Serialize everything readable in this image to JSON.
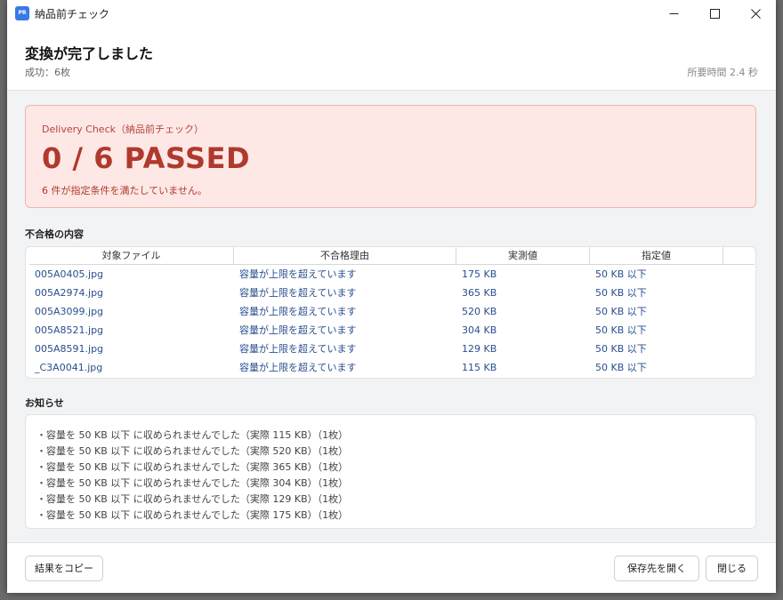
{
  "window": {
    "app_icon_text": "PR",
    "title": "納品前チェック"
  },
  "header": {
    "title": "変換が完了しました",
    "subtitle": "成功：6枚",
    "elapsed": "所要時間 2.4 秒"
  },
  "alert": {
    "label": "Delivery Check（納品前チェック）",
    "result": "0 / 6 PASSED",
    "description": "6 件が指定条件を満たしていません。"
  },
  "failures": {
    "section_title": "不合格の内容",
    "columns": [
      "対象ファイル",
      "不合格理由",
      "実測値",
      "指定値"
    ],
    "rows": [
      {
        "file": "005A0405.jpg",
        "reason": "容量が上限を超えています",
        "actual": "175 KB",
        "spec": "50 KB 以下"
      },
      {
        "file": "005A2974.jpg",
        "reason": "容量が上限を超えています",
        "actual": "365 KB",
        "spec": "50 KB 以下"
      },
      {
        "file": "005A3099.jpg",
        "reason": "容量が上限を超えています",
        "actual": "520 KB",
        "spec": "50 KB 以下"
      },
      {
        "file": "005A8521.jpg",
        "reason": "容量が上限を超えています",
        "actual": "304 KB",
        "spec": "50 KB 以下"
      },
      {
        "file": "005A8591.jpg",
        "reason": "容量が上限を超えています",
        "actual": "129 KB",
        "spec": "50 KB 以下"
      },
      {
        "file": "_C3A0041.jpg",
        "reason": "容量が上限を超えています",
        "actual": "115 KB",
        "spec": "50 KB 以下"
      }
    ]
  },
  "notices": {
    "section_title": "お知らせ",
    "items": [
      "・容量を 50 KB 以下 に収められませんでした（実際 115 KB）（1枚）",
      "・容量を 50 KB 以下 に収められませんでした（実際 520 KB）（1枚）",
      "・容量を 50 KB 以下 に収められませんでした（実際 365 KB）（1枚）",
      "・容量を 50 KB 以下 に収められませんでした（実際 304 KB）（1枚）",
      "・容量を 50 KB 以下 に収められませんでした（実際 129 KB）（1枚）",
      "・容量を 50 KB 以下 に収められませんでした（実際 175 KB）（1枚）"
    ]
  },
  "footer": {
    "copy_label": "結果をコピー",
    "open_folder_label": "保存先を開く",
    "close_label": "閉じる"
  },
  "colors": {
    "alert_bg": "#fde8e6",
    "alert_text": "#b0392d",
    "link_text": "#2a4f8f",
    "app_icon": "#3a78e8"
  }
}
